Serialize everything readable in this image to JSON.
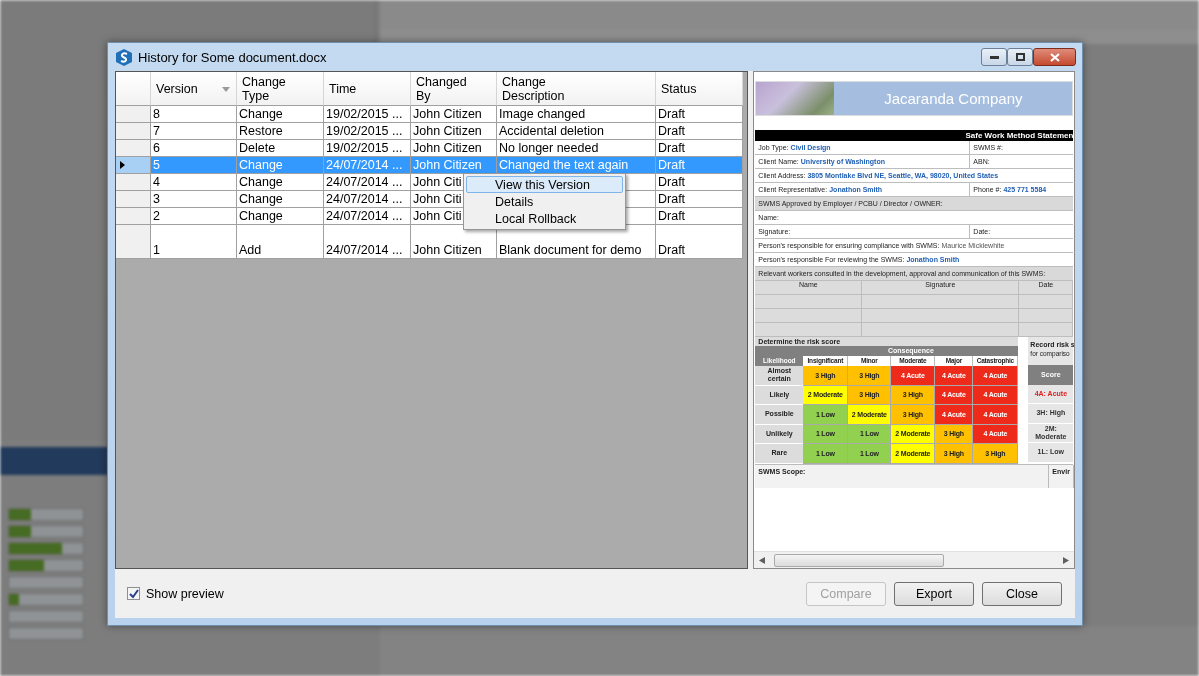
{
  "window": {
    "title": "History for Some document.docx"
  },
  "table": {
    "columns": [
      {
        "label": "Version",
        "sorted": true
      },
      {
        "label": "Change Type",
        "sorted": false
      },
      {
        "label": "Time",
        "sorted": false
      },
      {
        "label": "Changed By",
        "sorted": false
      },
      {
        "label": "Change Description",
        "sorted": false
      },
      {
        "label": "Status",
        "sorted": false
      }
    ],
    "rows": [
      {
        "version": "8",
        "change_type": "Change",
        "time": "19/02/2015 ...",
        "changed_by": "John Citizen",
        "description": "Image changed",
        "status": "Draft",
        "selected": false
      },
      {
        "version": "7",
        "change_type": "Restore",
        "time": "19/02/2015 ...",
        "changed_by": "John Citizen",
        "description": "Accidental deletion",
        "status": "Draft",
        "selected": false
      },
      {
        "version": "6",
        "change_type": "Delete",
        "time": "19/02/2015 ...",
        "changed_by": "John Citizen",
        "description": "No longer needed",
        "status": "Draft",
        "selected": false
      },
      {
        "version": "5",
        "change_type": "Change",
        "time": "24/07/2014 ...",
        "changed_by": "John Citizen",
        "description": "Changed the text again",
        "status": "Draft",
        "selected": true
      },
      {
        "version": "4",
        "change_type": "Change",
        "time": "24/07/2014 ...",
        "changed_by": "John Citi",
        "status": "Draft",
        "selected": false
      },
      {
        "version": "3",
        "change_type": "Change",
        "time": "24/07/2014 ...",
        "changed_by": "John Citi",
        "status": "Draft",
        "selected": false
      },
      {
        "version": "2",
        "change_type": "Change",
        "time": "24/07/2014 ...",
        "changed_by": "John Citi",
        "status": "Draft",
        "selected": false
      },
      {
        "version": "1",
        "change_type": "Add",
        "time": "24/07/2014 ...",
        "changed_by": "John Citizen",
        "description": "Blank document for demo",
        "status": "Draft",
        "selected": false
      }
    ]
  },
  "context_menu": {
    "items": [
      {
        "label": "View this Version",
        "selected": true
      },
      {
        "label": "Details",
        "selected": false
      },
      {
        "label": "Local Rollback",
        "selected": false
      }
    ]
  },
  "preview": {
    "company": "Jacaranda Company",
    "heading": "Safe Work Method Statemen",
    "form_rows": [
      {
        "kind": "pair",
        "cells": [
          {
            "label": "Job Type:",
            "value": "Civil Design",
            "filled": true
          },
          {
            "label": "SWMS #:"
          }
        ]
      },
      {
        "kind": "pair",
        "cells": [
          {
            "label": "Client Name:",
            "value": "University of Washington",
            "filled": true
          },
          {
            "label": "ABN:"
          }
        ]
      },
      {
        "kind": "single",
        "cells": [
          {
            "label": "Client Address:",
            "value": "3805 Montlake Blvd NE, Seattle, WA, 98020, United States",
            "filled": true
          }
        ]
      },
      {
        "kind": "pair",
        "cells": [
          {
            "label": "Client Representative:",
            "value": "Jonathon Smith",
            "filled": true
          },
          {
            "label": "Phone #:",
            "value": "425 771 5584",
            "filled": true
          }
        ]
      },
      {
        "kind": "section",
        "cells": [
          {
            "label": "SWMS Approved by Employer / PCBU / Director / OWNER:"
          }
        ]
      },
      {
        "kind": "single",
        "cells": [
          {
            "label": "Name:"
          }
        ]
      },
      {
        "kind": "pair",
        "cells": [
          {
            "label": "Signature:"
          },
          {
            "label": "Date:"
          }
        ]
      },
      {
        "kind": "single",
        "cells": [
          {
            "label": "Person's responsible for ensuring compliance with SWMS:",
            "value": "Maurice Micklewhite",
            "filled": false
          }
        ]
      },
      {
        "kind": "single",
        "cells": [
          {
            "label": "Person's responsible For reviewing the SWMS:",
            "value": "Jonathon Smith",
            "filled": true
          }
        ]
      },
      {
        "kind": "section",
        "cells": [
          {
            "label": "Relevant workers consulted in the development, approval and communication of this SWMS:"
          }
        ]
      }
    ],
    "workers_columns": [
      "Name",
      "Signature",
      "Date"
    ],
    "risk": {
      "title": "Determine the risk score",
      "consequence": "Consequence",
      "likelihood": "Likelihood",
      "columns": [
        "Insignificant",
        "Minor",
        "Moderate",
        "Major",
        "Catastrophic"
      ],
      "rows": [
        {
          "label": "Almost certain",
          "cells": [
            {
              "text": "3 High",
              "color": "#ffc000"
            },
            {
              "text": "3 High",
              "color": "#ffc000"
            },
            {
              "text": "4 Acute",
              "color": "#ee2a1a"
            },
            {
              "text": "4 Acute",
              "color": "#ee2a1a"
            },
            {
              "text": "4 Acute",
              "color": "#ee2a1a"
            }
          ]
        },
        {
          "label": "Likely",
          "cells": [
            {
              "text": "2 Moderate",
              "color": "#ffff00"
            },
            {
              "text": "3 High",
              "color": "#ffc000"
            },
            {
              "text": "3 High",
              "color": "#ffc000"
            },
            {
              "text": "4 Acute",
              "color": "#ee2a1a"
            },
            {
              "text": "4 Acute",
              "color": "#ee2a1a"
            }
          ]
        },
        {
          "label": "Possible",
          "cells": [
            {
              "text": "1 Low",
              "color": "#92d050"
            },
            {
              "text": "2 Moderate",
              "color": "#ffff00"
            },
            {
              "text": "3 High",
              "color": "#ffc000"
            },
            {
              "text": "4 Acute",
              "color": "#ee2a1a"
            },
            {
              "text": "4 Acute",
              "color": "#ee2a1a"
            }
          ]
        },
        {
          "label": "Unlikely",
          "cells": [
            {
              "text": "1 Low",
              "color": "#92d050"
            },
            {
              "text": "1 Low",
              "color": "#92d050"
            },
            {
              "text": "2 Moderate",
              "color": "#ffff00"
            },
            {
              "text": "3 High",
              "color": "#ffc000"
            },
            {
              "text": "4 Acute",
              "color": "#ee2a1a"
            }
          ]
        },
        {
          "label": "Rare",
          "cells": [
            {
              "text": "1 Low",
              "color": "#92d050"
            },
            {
              "text": "1 Low",
              "color": "#92d050"
            },
            {
              "text": "2 Moderate",
              "color": "#ffff00"
            },
            {
              "text": "3 High",
              "color": "#ffc000"
            },
            {
              "text": "3 High",
              "color": "#ffc000"
            }
          ]
        }
      ]
    },
    "record": {
      "title": "Record risk s",
      "subtitle": "for compariso",
      "score_label": "Score",
      "scores": [
        {
          "text": "4A: Acute",
          "color": "#e02020"
        },
        {
          "text": "3H: High",
          "color": "#333333"
        },
        {
          "text": "2M: Moderate",
          "color": "#333333"
        },
        {
          "text": "1L: Low",
          "color": "#333333"
        }
      ]
    },
    "scope_label": "SWMS Scope:",
    "scope_right": "Envir"
  },
  "show_preview": {
    "label": "Show preview",
    "checked": true
  },
  "buttons": [
    {
      "label": "Compare",
      "disabled": true
    },
    {
      "label": "Export",
      "disabled": false
    },
    {
      "label": "Close",
      "disabled": false
    }
  ]
}
